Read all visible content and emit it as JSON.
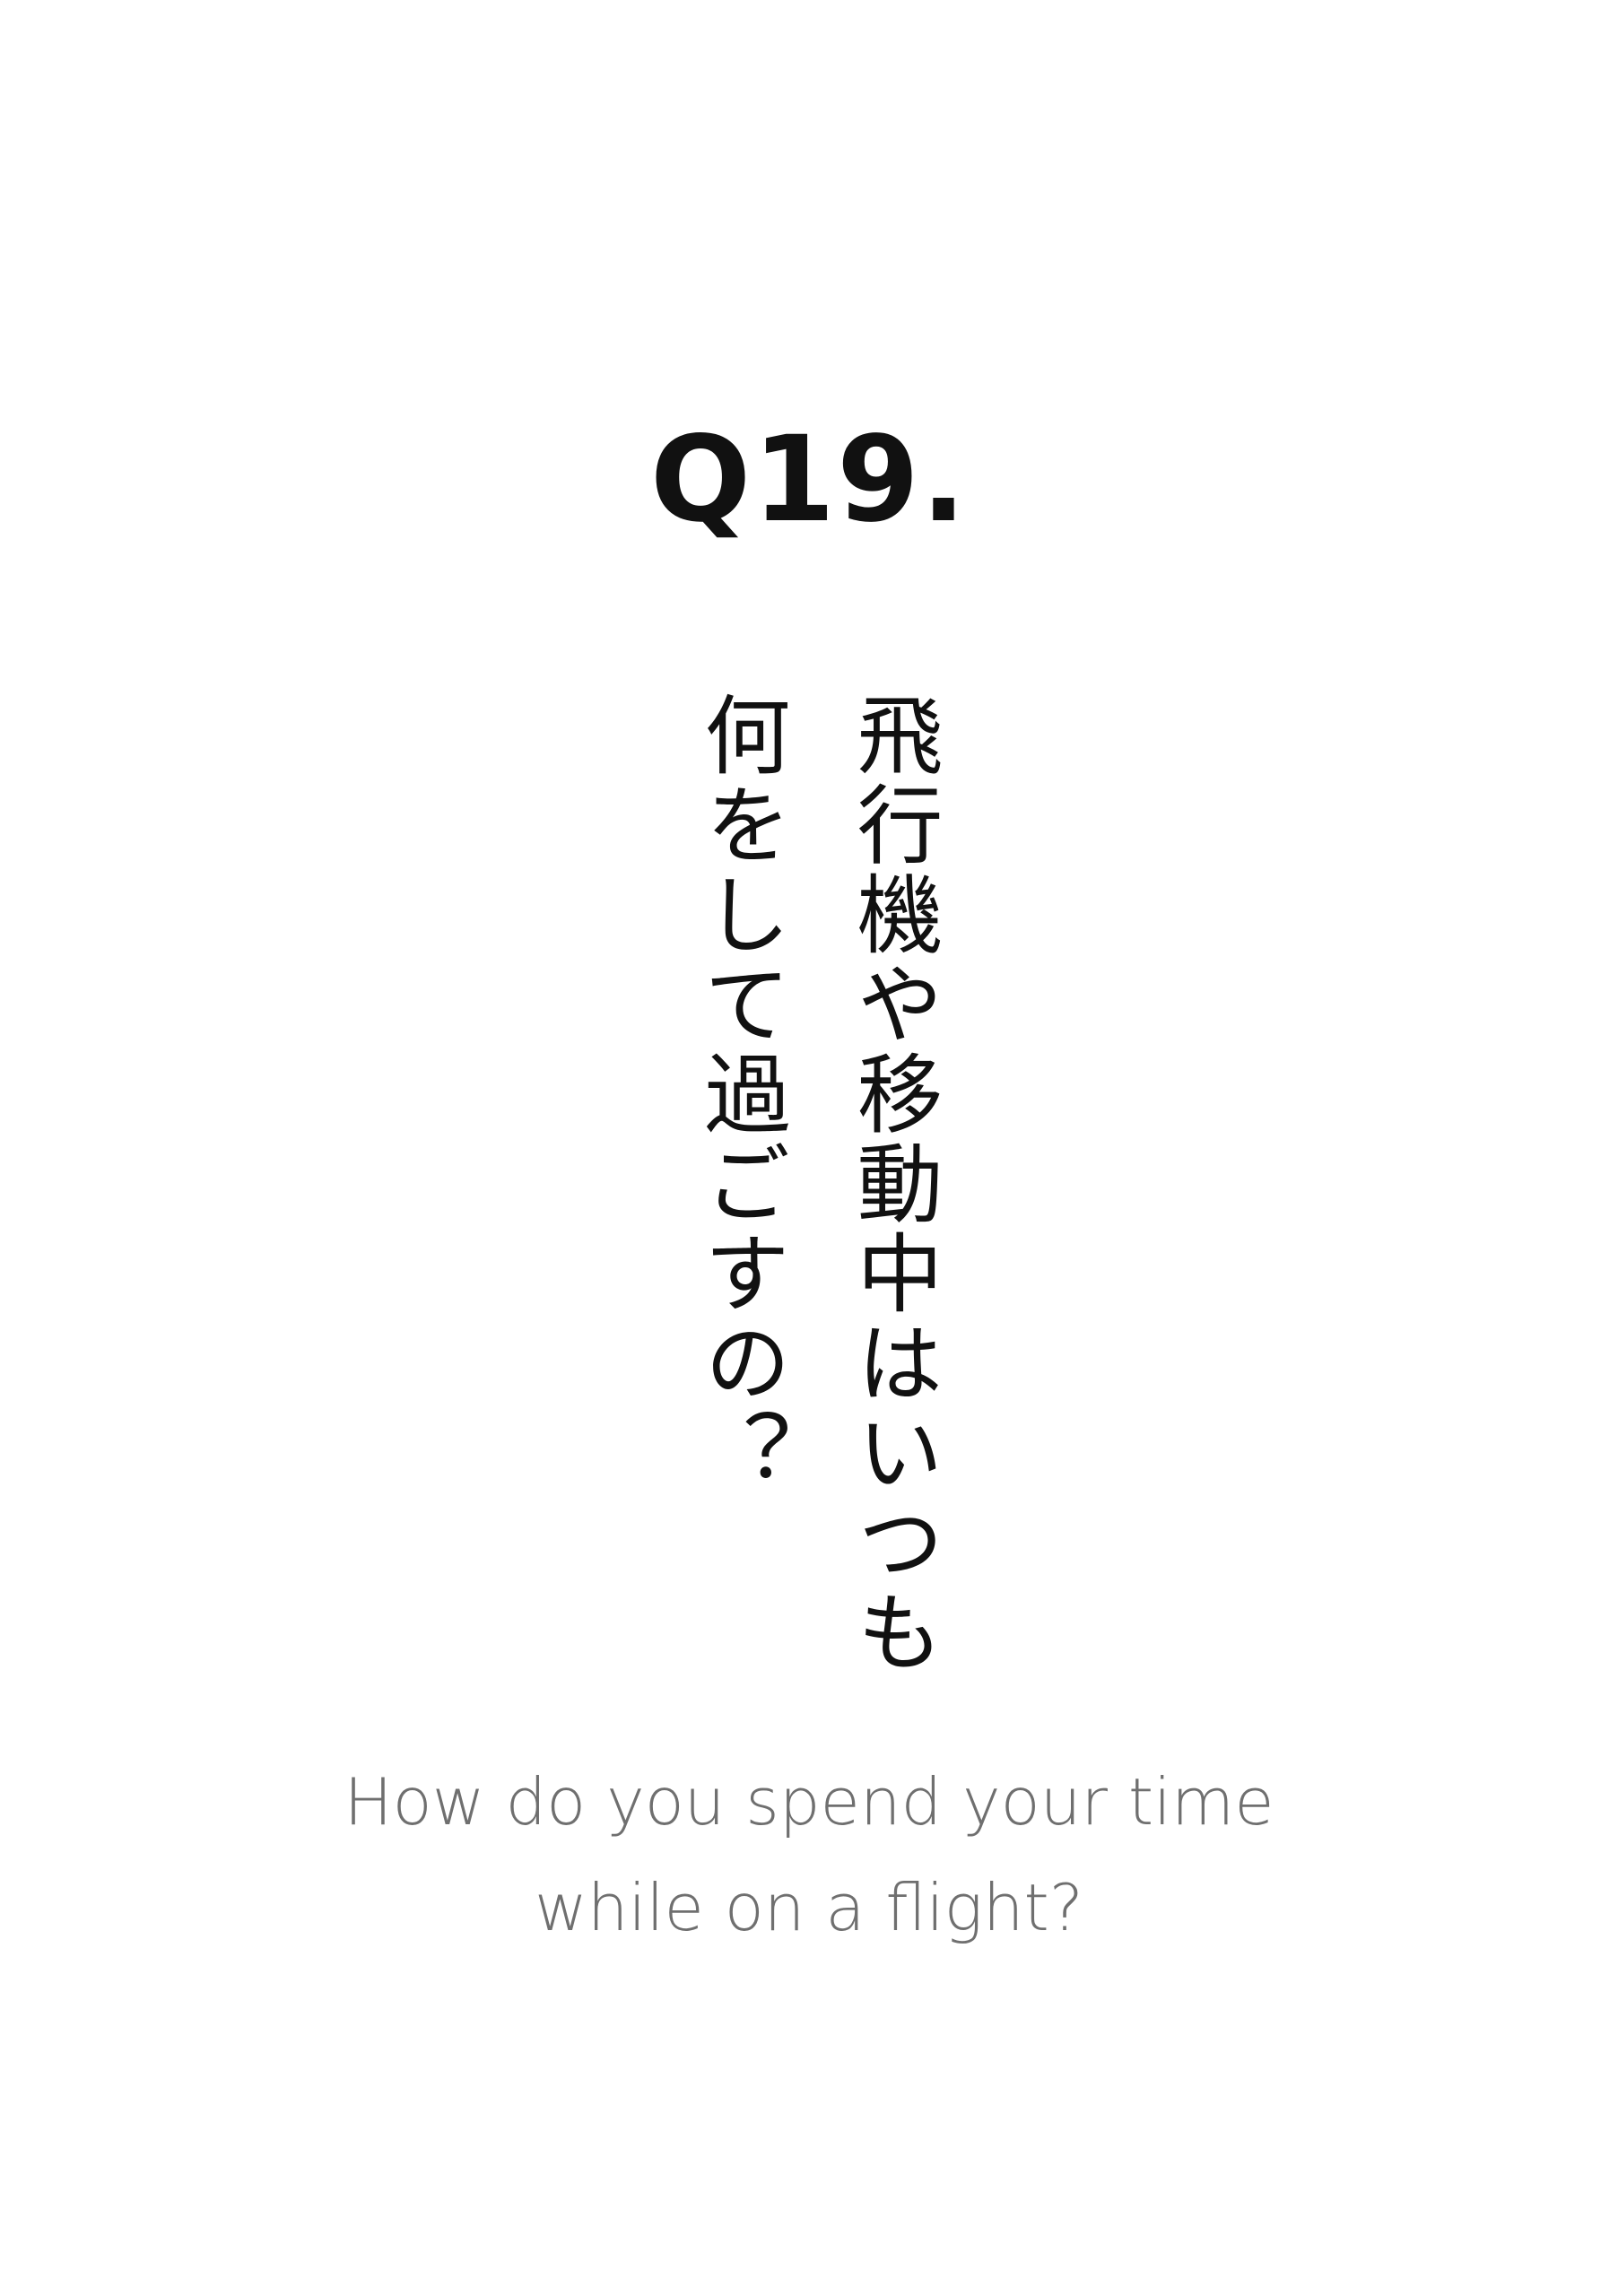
{
  "question": {
    "number": "Q19."
  },
  "japanese": {
    "lines": [
      "飛行機や移動中はいつも",
      "何をして過ごすの？"
    ]
  },
  "english": {
    "lines": [
      "How do you spend your time",
      "while on a flight?"
    ]
  },
  "colors": {
    "background": "#ffffff",
    "title": "#111111",
    "japanese_text": "#111111",
    "english_text": "#6f6f6f"
  }
}
